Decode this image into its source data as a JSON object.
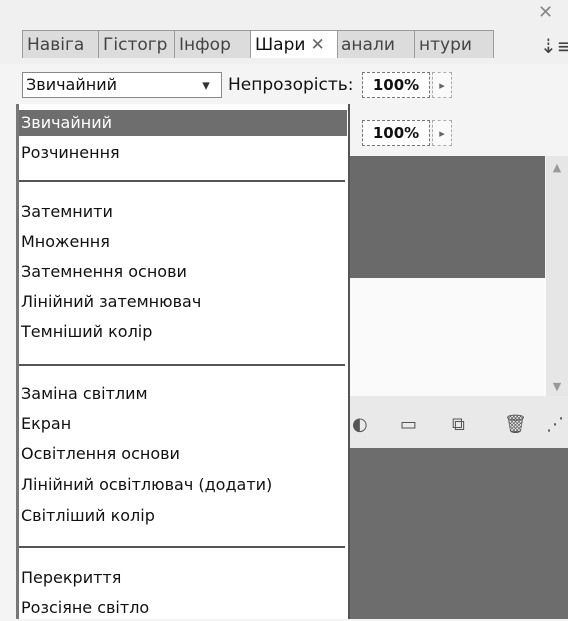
{
  "tabs": [
    {
      "label": "Навіга"
    },
    {
      "label": "Гістогр"
    },
    {
      "label": "Інфор"
    },
    {
      "label": "Шари",
      "close": "✕",
      "active": true
    },
    {
      "label": "анали"
    },
    {
      "label": "нтури"
    }
  ],
  "panel": {
    "close_glyph": "✕",
    "menu_glyph": "⇣≡"
  },
  "blend_mode": {
    "value": "Звичайний",
    "arrow": "▾"
  },
  "opacity": {
    "label": "Непрозорість:",
    "value": "100%",
    "arrow": "▸"
  },
  "fill": {
    "value": "100%",
    "arrow": "▸"
  },
  "scroll": {
    "up": "▲",
    "down": "▼"
  },
  "toolbar_icons": [
    "◐",
    "▭",
    "⧉",
    "🗑",
    "⋰"
  ],
  "blend_menu": {
    "groups": [
      [
        "Звичайний",
        "Розчинення"
      ],
      [
        "Затемнити",
        "Множення",
        "Затемнення основи",
        "Лінійний затемнювач",
        "Темніший колір"
      ],
      [
        "Заміна світлим",
        "Екран",
        "Освітлення основи",
        "Лінійний освітлювач (додати)",
        "Світліший колір"
      ],
      [
        "Перекриття",
        "Розсіяне світло"
      ]
    ],
    "selected": "Звичайний"
  }
}
